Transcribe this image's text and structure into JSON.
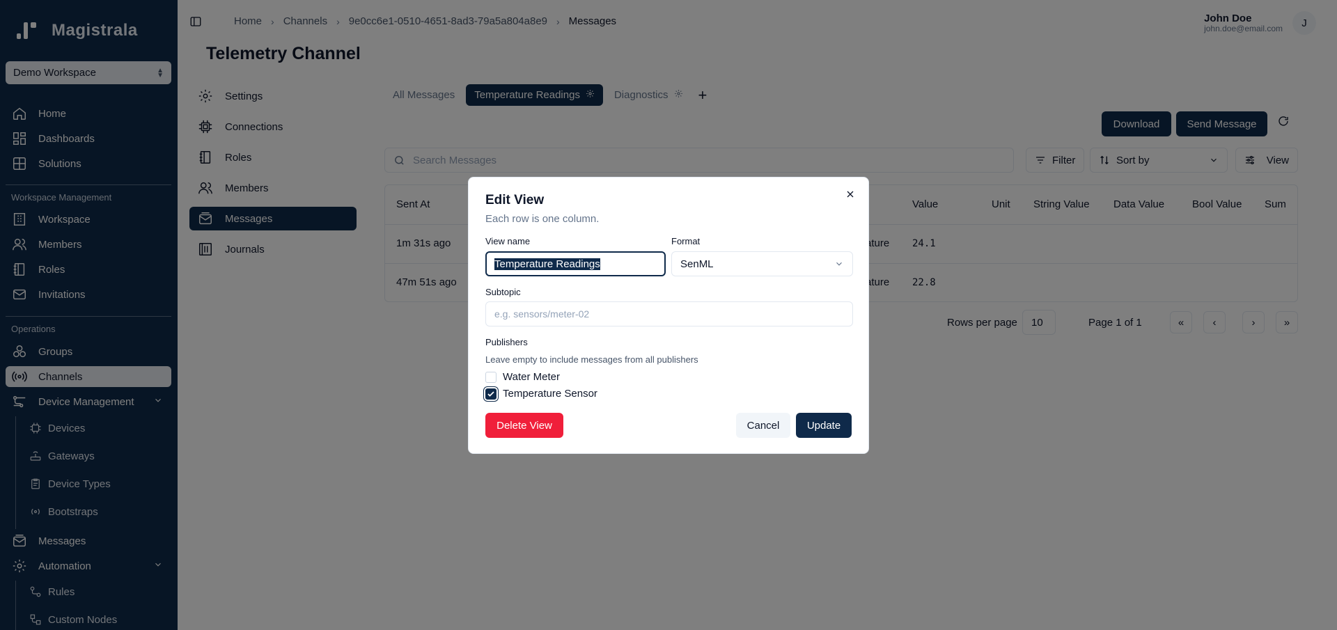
{
  "app": {
    "name": "Magistrala"
  },
  "sidebar": {
    "workspace": "Demo Workspace",
    "items": [
      {
        "label": "Home",
        "icon": "home-icon"
      },
      {
        "label": "Dashboards",
        "icon": "dashboard-icon"
      },
      {
        "label": "Solutions",
        "icon": "solutions-icon"
      }
    ],
    "workspace_section": {
      "label": "Workspace Management",
      "items": [
        {
          "label": "Workspace",
          "icon": "building-icon"
        },
        {
          "label": "Members",
          "icon": "users-icon"
        },
        {
          "label": "Roles",
          "icon": "notebook-icon"
        },
        {
          "label": "Invitations",
          "icon": "mail-icon"
        }
      ]
    },
    "operations_section": {
      "label": "Operations",
      "items": [
        {
          "label": "Groups",
          "icon": "groups-icon"
        },
        {
          "label": "Channels",
          "icon": "radio-icon",
          "active": true
        },
        {
          "label": "Device Management",
          "icon": "device-management-icon"
        },
        {
          "label": "Messages",
          "icon": "messages-icon"
        },
        {
          "label": "Automation",
          "icon": "gear-icon"
        }
      ],
      "device_sub": [
        "Devices",
        "Gateways",
        "Device Types",
        "Bootstraps"
      ],
      "automation_sub": [
        "Rules",
        "Custom Nodes"
      ]
    }
  },
  "header": {
    "breadcrumb": [
      "Home",
      "Channels",
      "9e0cc6e1-0510-4651-8ad3-79a5a804a8e9",
      "Messages"
    ],
    "user_name": "John Doe",
    "user_email": "john.doe@email.com",
    "avatar_initial": "J"
  },
  "page": {
    "title": "Telemetry Channel",
    "channel_nav": [
      "Settings",
      "Connections",
      "Roles",
      "Members",
      "Messages",
      "Journals"
    ],
    "tabs": [
      "All Messages",
      "Temperature Readings",
      "Diagnostics"
    ],
    "download_label": "Download",
    "send_label": "Send Message",
    "search_placeholder": "Search Messages",
    "filter_label": "Filter",
    "sort_label": "Sort by",
    "view_label": "View",
    "table": {
      "columns": [
        "Sent At",
        "Value",
        "Unit",
        "String Value",
        "Data Value",
        "Bool Value",
        "Sum"
      ],
      "rows": [
        {
          "sent_at": "1m 31s ago",
          "name_fragment": "ature",
          "value": "24.1"
        },
        {
          "sent_at": "47m 51s ago",
          "name_fragment": "ature",
          "value": "22.8"
        }
      ]
    },
    "rows_per_page_label": "Rows per page",
    "rows_per_page": "10",
    "page_label": "Page 1 of 1"
  },
  "modal": {
    "title": "Edit View",
    "description": "Each row is one column.",
    "view_name_label": "View name",
    "view_name": "Temperature Readings",
    "format_label": "Format",
    "format_value": "SenML",
    "subtopic_label": "Subtopic",
    "subtopic_placeholder": "e.g. sensors/meter-02",
    "publishers_label": "Publishers",
    "publishers_help": "Leave empty to include messages from all publishers",
    "publishers": [
      {
        "label": "Water Meter",
        "checked": false
      },
      {
        "label": "Temperature Sensor",
        "checked": true
      }
    ],
    "delete_label": "Delete View",
    "cancel_label": "Cancel",
    "update_label": "Update"
  },
  "colors": {
    "primary": "#0f2a4a",
    "danger": "#f01f3a",
    "sidebar_bg": "#0f2a4a"
  }
}
